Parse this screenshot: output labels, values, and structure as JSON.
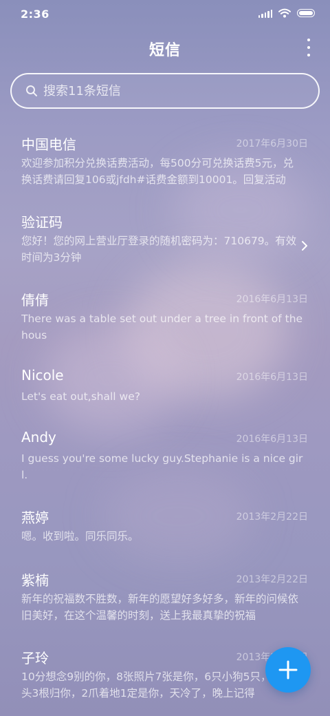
{
  "status_bar": {
    "time": "2:36",
    "battery_level": 1.0
  },
  "header": {
    "title": "短信",
    "menu_icon": "more-vertical-icon"
  },
  "search": {
    "placeholder": "搜索11条短信",
    "value": "",
    "icon": "search-icon"
  },
  "messages": [
    {
      "name": "中国电信",
      "date": "2017年6月30日",
      "preview": "欢迎参加积分兑换话费活动，每500分可兑换话费5元，兑换话费请回复106或jfdh#话费金额到10001。回复活动"
    },
    {
      "name": "验证码",
      "date": "",
      "preview": "您好！您的网上营业厅登录的随机密码为：710679。有效时间为3分钟",
      "chevron": "chevron-right-icon"
    },
    {
      "name": "倩倩",
      "date": "2016年6月13日",
      "preview": "There was a table set out under a tree in front of the hous"
    },
    {
      "name": "Nicole",
      "date": "2016年6月13日",
      "preview": "Let's eat out,shall we?"
    },
    {
      "name": "Andy",
      "date": "2016年6月13日",
      "preview": "I guess you're some lucky guy.Stephanie is a nice girl."
    },
    {
      "name": "燕婷",
      "date": "2013年2月22日",
      "preview": "嗯。收到啦。同乐同乐。"
    },
    {
      "name": "紫楠",
      "date": "2013年2月22日",
      "preview": "新年的祝福数不胜数，新年的愿望好多好多，新年的问候依旧美好，在这个温馨的时刻，送上我最真挚的祝福"
    },
    {
      "name": "子玲",
      "date": "2013年2月22日",
      "preview": "10分想念9别的你，8张照片7张是你，6只小狗5只，4根骨头3根归你，2爪着地1定是你，天冷了，晚上记得"
    }
  ],
  "fab": {
    "icon": "plus-icon",
    "color": "#1e97f2"
  },
  "colors": {
    "background_top": "#8a8fbb",
    "background_mid": "#a6a2c6",
    "accent": "#1e97f2"
  }
}
